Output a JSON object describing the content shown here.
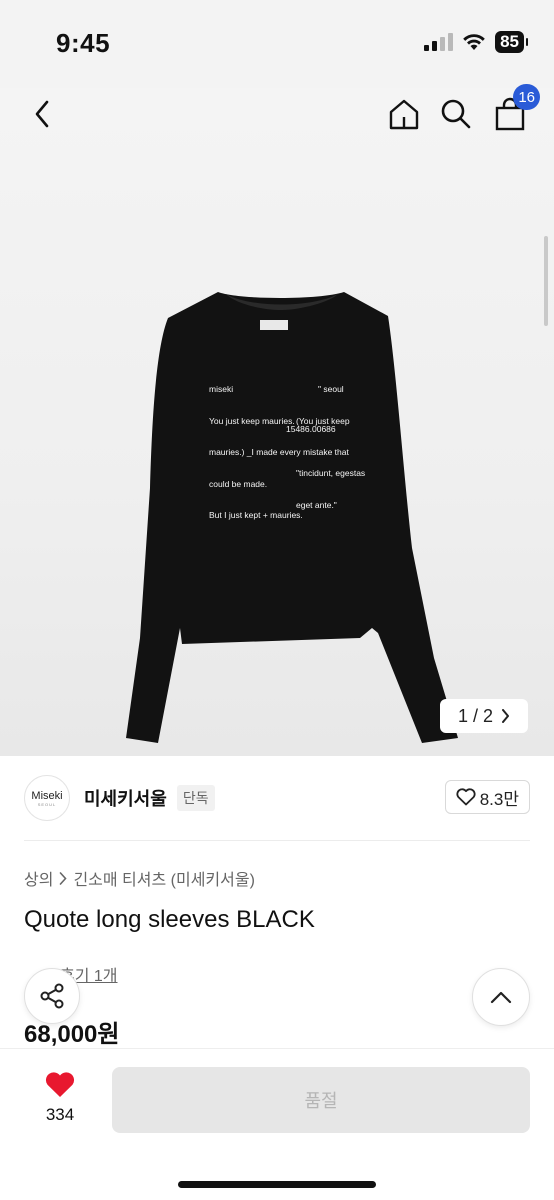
{
  "status_bar": {
    "time": "9:45",
    "battery": "85"
  },
  "nav": {
    "back_icon": "chevron-left-icon",
    "home_icon": "home-icon",
    "search_icon": "search-icon",
    "bag_icon": "shopping-bag-icon",
    "bag_count": "16"
  },
  "product_image": {
    "print_lines_left": [
      "miseki",
      "You just keep mauries.",
      "mauries.) _I made every mistake that",
      "could be made.",
      "But I just kept + mauries."
    ],
    "print_lines_right": [
      "\" seoul",
      "(You just keep",
      "",
      "\"tincidunt, egestas",
      "eget ante.\""
    ],
    "print_code": "15486.00686",
    "pager": {
      "current": "1",
      "total": "2",
      "separator": "/"
    }
  },
  "seller": {
    "logo_text": "Miseki",
    "logo_sub": "SEOUL",
    "name": "미세키서울",
    "tag": "단독",
    "likes": "8.3만"
  },
  "breadcrumb": {
    "root": "상의",
    "category": "긴소매 티셔츠 (미세키서울)"
  },
  "product": {
    "title": "Quote long sleeves BLACK",
    "review_text": "후기 1개",
    "price": "68,000원"
  },
  "bottom": {
    "wish_count": "334",
    "buy_label": "품절"
  },
  "colors": {
    "accent": "#2a5bd7",
    "heart": "#e8182f",
    "disabled_bg": "#e6e6e6"
  }
}
